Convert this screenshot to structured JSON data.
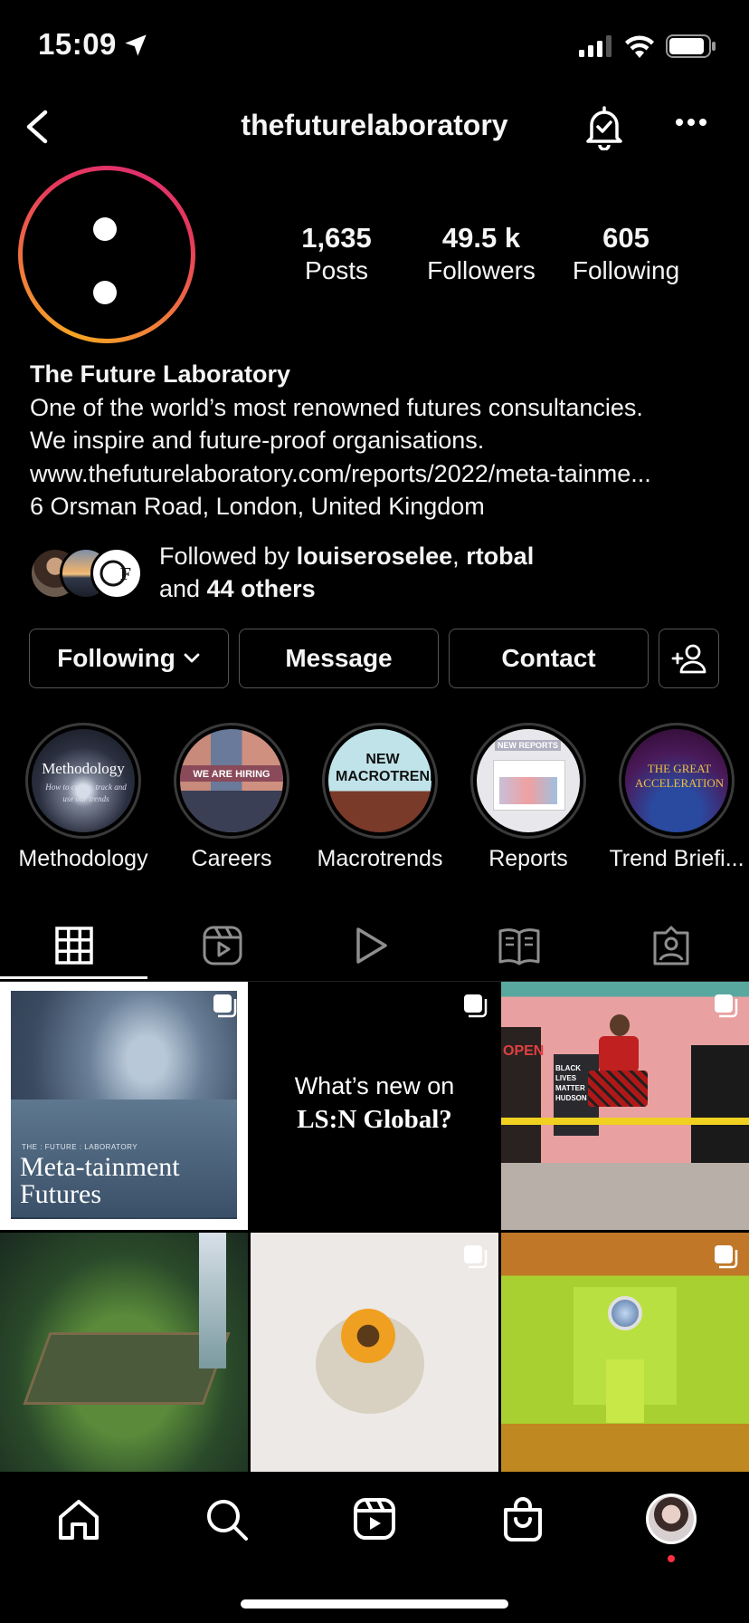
{
  "status": {
    "time": "15:09"
  },
  "nav": {
    "username": "thefuturelaboratory"
  },
  "stats": [
    {
      "value": "1,635",
      "label": "Posts"
    },
    {
      "value": "49.5 k",
      "label": "Followers"
    },
    {
      "value": "605",
      "label": "Following"
    }
  ],
  "bio": {
    "name": "The Future Laboratory",
    "line1": "One of the world’s most renowned futures consultancies.",
    "line2": "We inspire and future-proof organisations.",
    "link": "www.thefuturelaboratory.com/reports/2022/meta-tainme...",
    "address": "6 Orsman Road, London, United Kingdom"
  },
  "followed_by": {
    "prefix": "Followed by ",
    "user1": "louiseroselee",
    "sep": ", ",
    "user2": "rtobal",
    "and": "and ",
    "others": "44 others"
  },
  "buttons": {
    "following": "Following",
    "message": "Message",
    "contact": "Contact"
  },
  "highlights": [
    {
      "label": "Methodology",
      "cover_title": "Methodology",
      "cover_sub": "How to create, track and use our trends"
    },
    {
      "label": "Careers",
      "cover_title": "WE ARE HIRING"
    },
    {
      "label": "Macrotrends",
      "cover_title": "NEW MACROTRENDS"
    },
    {
      "label": "Reports",
      "cover_title": "NEW REPORTS"
    },
    {
      "label": "Trend Briefi...",
      "cover_title": "THE GREAT ACCELERATION"
    }
  ],
  "posts": {
    "post1": {
      "kicker": "THE : FUTURE : LABORATORY",
      "title_line1": "Meta-tainment",
      "title_line2": "Futures"
    },
    "post2": {
      "line1": "What’s new on",
      "line2": "LS:N Global?"
    },
    "post3": {
      "sign1": "OPEN",
      "sign2": "BLACK LIVES MATTER HUDSON"
    }
  },
  "colors": {
    "background": "#000000",
    "text": "#f5f5f5",
    "ring_start": "#f5a623",
    "ring_end": "#e0306e",
    "notification_dot": "#ff3040"
  }
}
